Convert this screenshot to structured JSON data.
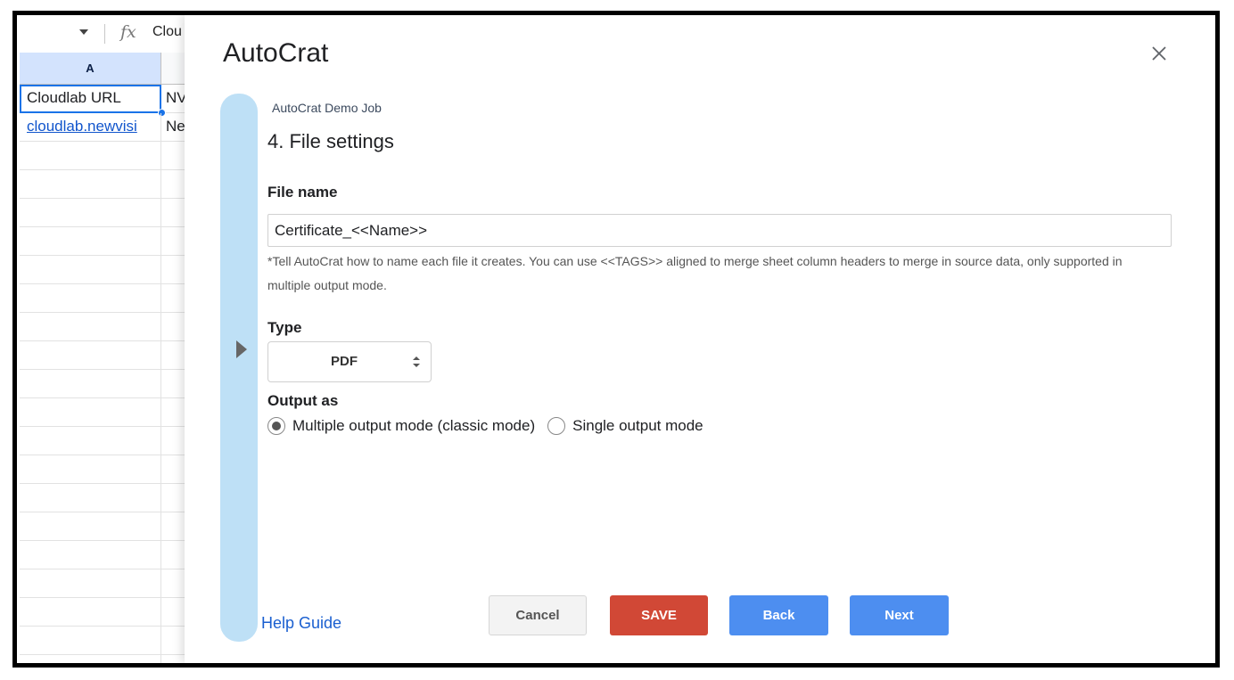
{
  "sheet": {
    "formula_bar": {
      "fx_symbol": "fx",
      "value": "Clou"
    },
    "column_header": "A",
    "rows": [
      {
        "a": "Cloudlab URL",
        "b": "NV"
      },
      {
        "a": "cloudlab.newvisi",
        "b": "Ne"
      }
    ]
  },
  "dialog": {
    "title": "AutoCrat",
    "close_icon": "close-icon",
    "job_name": "AutoCrat Demo Job",
    "step_title": "4. File settings",
    "file_name": {
      "label": "File name",
      "value": "Certificate_<<Name>>",
      "hint": "*Tell AutoCrat how to name each file it creates. You can use <<TAGS>> aligned to merge sheet column headers to merge in source data, only supported in multiple output mode."
    },
    "type": {
      "label": "Type",
      "selected": "PDF"
    },
    "output": {
      "label": "Output as",
      "options": [
        {
          "label": "Multiple output mode (classic mode)",
          "checked": true
        },
        {
          "label": "Single output mode",
          "checked": false
        }
      ]
    },
    "help_link": "Help Guide",
    "buttons": {
      "cancel": "Cancel",
      "save": "SAVE",
      "back": "Back",
      "next": "Next"
    }
  },
  "colors": {
    "save": "#d14836",
    "primary": "#4d8ef0",
    "rail": "#bee0f6",
    "selection": "#1a73e8"
  }
}
